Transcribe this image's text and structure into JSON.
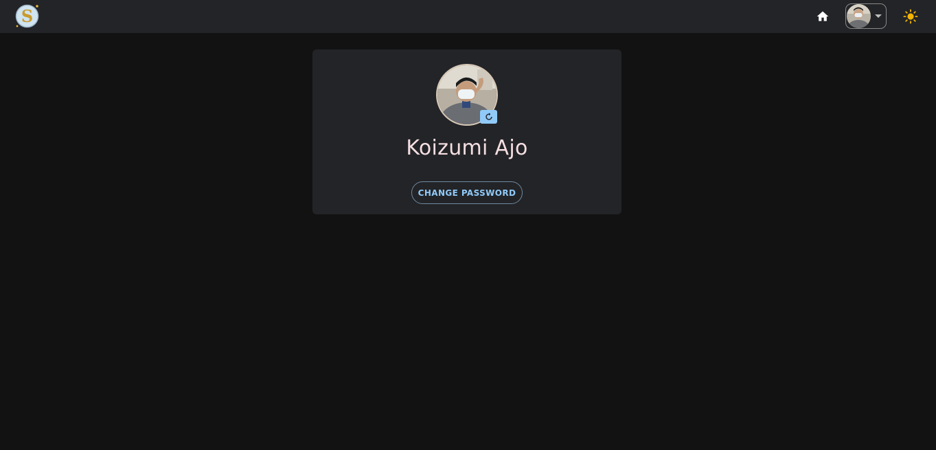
{
  "header": {
    "logo_icon": "app-logo-s-icon",
    "home_icon": "home-icon",
    "account_menu_icon": "chevron-down-icon",
    "theme_icon": "sun-icon"
  },
  "profile": {
    "name": "Koizumi Ajo",
    "change_password_label": "CHANGE PASSWORD",
    "camera_icon": "camera-icon"
  },
  "colors": {
    "background": "#121212",
    "surface": "#232427",
    "accent": "#90caf9",
    "sun": "#f4b400",
    "name_text": "#f4dfe2"
  }
}
